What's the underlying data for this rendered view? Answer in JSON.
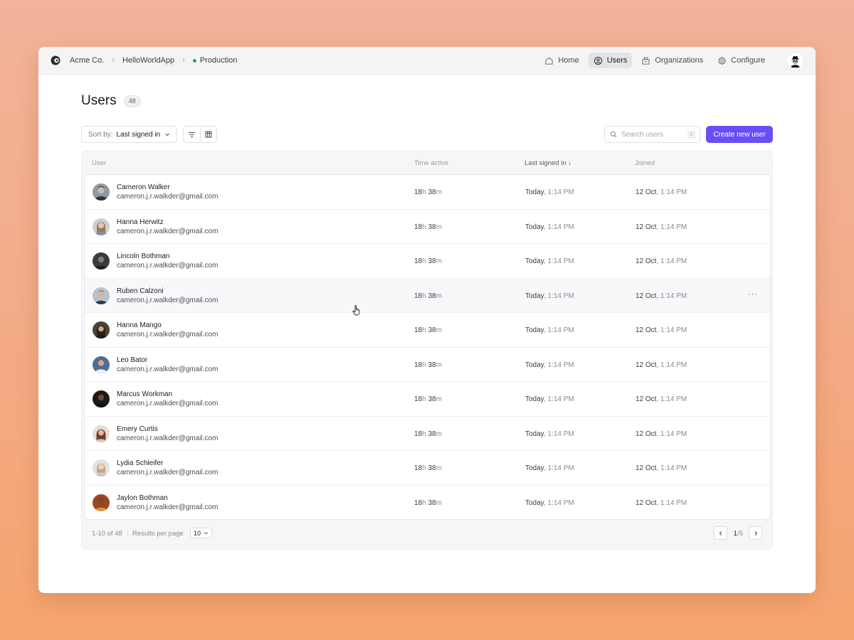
{
  "breadcrumb": {
    "org": "Acme Co.",
    "app": "HelloWorldApp",
    "environment": "Production",
    "environment_color": "#22a756"
  },
  "nav": {
    "items": [
      {
        "label": "Home",
        "icon": "home-icon",
        "active": false
      },
      {
        "label": "Users",
        "icon": "user-circle-icon",
        "active": true
      },
      {
        "label": "Organizations",
        "icon": "building-icon",
        "active": false
      },
      {
        "label": "Configure",
        "icon": "gear-icon",
        "active": false
      }
    ]
  },
  "page": {
    "title": "Users",
    "count": "48"
  },
  "toolbar": {
    "sort_label": "Sort by:",
    "sort_value": "Last signed in",
    "search_placeholder": "Search users",
    "search_shortcut": "/",
    "create_label": "Create new user",
    "accent_color": "#6a4ef5"
  },
  "table": {
    "columns": {
      "user": "User",
      "time_active": "Time active",
      "last_signed_in": "Last signed in",
      "joined": "Joined"
    },
    "sort_indicator": "↓",
    "rows": [
      {
        "name": "Cameron Walker",
        "email": "cameron.j.r.walkder@gmail.com",
        "hours": "18",
        "h_unit": "h",
        "minutes": "38",
        "m_unit": "m",
        "signed_day": "Today",
        "signed_time": ", 1:14 PM",
        "joined_date": "12 Oct",
        "joined_time": ", 1:14 PM"
      },
      {
        "name": "Hanna Herwitz",
        "email": "cameron.j.r.walkder@gmail.com",
        "hours": "18",
        "h_unit": "h",
        "minutes": "38",
        "m_unit": "m",
        "signed_day": "Today",
        "signed_time": ", 1:14 PM",
        "joined_date": "12 Oct",
        "joined_time": ", 1:14 PM"
      },
      {
        "name": "Lincoln Bothman",
        "email": "cameron.j.r.walkder@gmail.com",
        "hours": "18",
        "h_unit": "h",
        "minutes": "38",
        "m_unit": "m",
        "signed_day": "Today",
        "signed_time": ", 1:14 PM",
        "joined_date": "12 Oct",
        "joined_time": ", 1:14 PM"
      },
      {
        "name": "Ruben Calzoni",
        "email": "cameron.j.r.walkder@gmail.com",
        "hours": "18",
        "h_unit": "h",
        "minutes": "38",
        "m_unit": "m",
        "signed_day": "Today",
        "signed_time": ", 1:14 PM",
        "joined_date": "12 Oct",
        "joined_time": ", 1:14 PM",
        "more": "···"
      },
      {
        "name": "Hanna Mango",
        "email": "cameron.j.r.walkder@gmail.com",
        "hours": "18",
        "h_unit": "h",
        "minutes": "38",
        "m_unit": "m",
        "signed_day": "Today",
        "signed_time": ", 1:14 PM",
        "joined_date": "12 Oct",
        "joined_time": ", 1:14 PM"
      },
      {
        "name": "Leo Bator",
        "email": "cameron.j.r.walkder@gmail.com",
        "hours": "18",
        "h_unit": "h",
        "minutes": "38",
        "m_unit": "m",
        "signed_day": "Today",
        "signed_time": ", 1:14 PM",
        "joined_date": "12 Oct",
        "joined_time": ", 1:14 PM"
      },
      {
        "name": "Marcus Workman",
        "email": "cameron.j.r.walkder@gmail.com",
        "hours": "18",
        "h_unit": "h",
        "minutes": "38",
        "m_unit": "m",
        "signed_day": "Today",
        "signed_time": ", 1:14 PM",
        "joined_date": "12 Oct",
        "joined_time": ", 1:14 PM"
      },
      {
        "name": "Emery Curtis",
        "email": "cameron.j.r.walkder@gmail.com",
        "hours": "18",
        "h_unit": "h",
        "minutes": "38",
        "m_unit": "m",
        "signed_day": "Today",
        "signed_time": ", 1:14 PM",
        "joined_date": "12 Oct",
        "joined_time": ", 1:14 PM"
      },
      {
        "name": "Lydia Schleifer",
        "email": "cameron.j.r.walkder@gmail.com",
        "hours": "18",
        "h_unit": "h",
        "minutes": "38",
        "m_unit": "m",
        "signed_day": "Today",
        "signed_time": ", 1:14 PM",
        "joined_date": "12 Oct",
        "joined_time": ", 1:14 PM"
      },
      {
        "name": "Jaylon Bothman",
        "email": "cameron.j.r.walkder@gmail.com",
        "hours": "18",
        "h_unit": "h",
        "minutes": "38",
        "m_unit": "m",
        "signed_day": "Today",
        "signed_time": ", 1:14 PM",
        "joined_date": "12 Oct",
        "joined_time": ", 1:14 PM"
      }
    ]
  },
  "footer": {
    "range": "1-10 of 48",
    "results_label": "Results per page",
    "results_value": "10",
    "page_current": "1",
    "page_total": "/5"
  }
}
